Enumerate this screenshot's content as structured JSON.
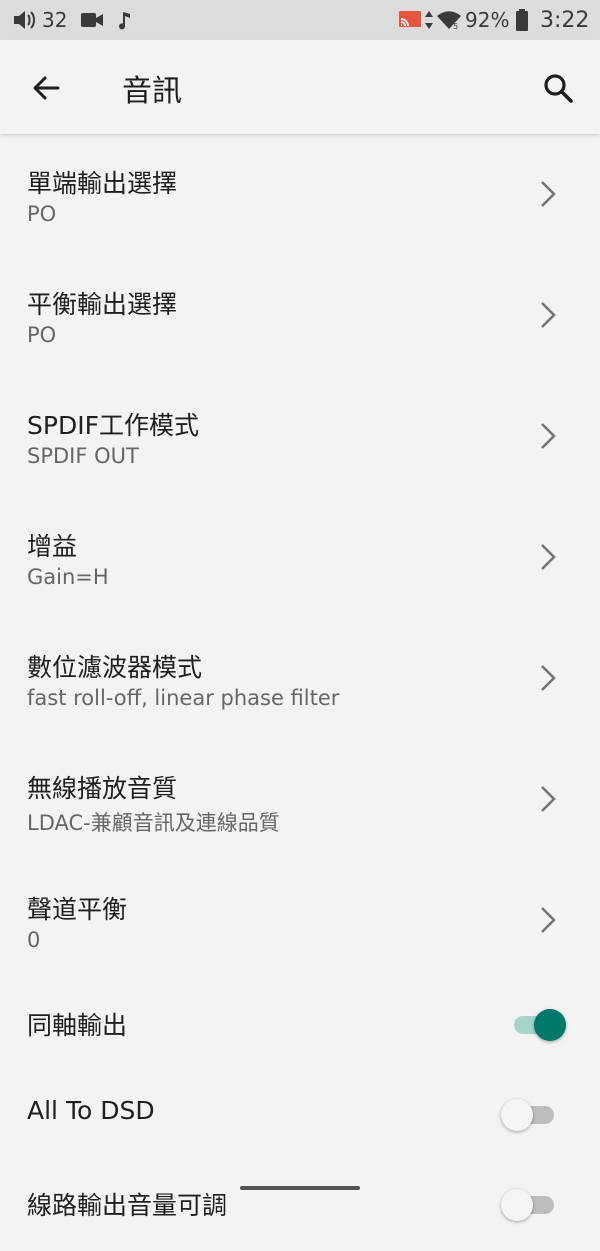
{
  "status_bar": {
    "volume_level": "32",
    "battery_percent": "92%",
    "time": "3:22",
    "icons": [
      "volume-icon",
      "video-icon",
      "music-note-icon",
      "cast-icon",
      "data-arrows-icon",
      "wifi-icon",
      "battery-icon"
    ]
  },
  "app_bar": {
    "title": "音訊",
    "back_icon": "arrow-back-icon",
    "search_icon": "search-icon"
  },
  "settings": [
    {
      "title": "單端輸出選擇",
      "summary": "PO"
    },
    {
      "title": "平衡輸出選擇",
      "summary": "PO"
    },
    {
      "title": "SPDIF工作模式",
      "summary": "SPDIF OUT"
    },
    {
      "title": "增益",
      "summary": "Gain=H"
    },
    {
      "title": "數位濾波器模式",
      "summary": "fast roll-off, linear phase filter"
    },
    {
      "title": "無線播放音質",
      "summary": "LDAC-兼顧音訊及連線品質"
    },
    {
      "title": "聲道平衡",
      "summary": "0"
    }
  ],
  "toggles": [
    {
      "title": "同軸輸出",
      "state": "on"
    },
    {
      "title": "All To DSD",
      "state": "off"
    },
    {
      "title": "線路輸出音量可調",
      "state": "off"
    }
  ],
  "colors": {
    "accent": "#00796b",
    "accent_track": "#a7d3cd",
    "background": "#f3f3f3",
    "status_bar": "#dcdcdc"
  }
}
